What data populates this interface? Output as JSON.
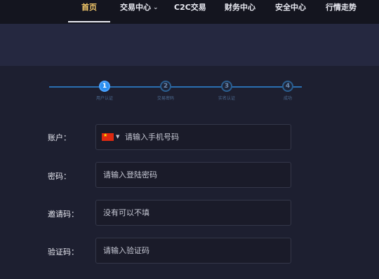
{
  "nav": {
    "items": [
      {
        "label": "首页",
        "active": true
      },
      {
        "label": "交易中心",
        "dropdown": true
      },
      {
        "label": "C2C交易"
      },
      {
        "label": "财务中心"
      },
      {
        "label": "安全中心"
      },
      {
        "label": "行情走势"
      }
    ]
  },
  "steps": [
    {
      "number": "1",
      "label": "用户认证",
      "active": true
    },
    {
      "number": "2",
      "label": "交易密码"
    },
    {
      "number": "3",
      "label": "实名认证"
    },
    {
      "number": "4",
      "label": "成功"
    }
  ],
  "form": {
    "account": {
      "label": "账户：",
      "placeholder": "请输入手机号码",
      "country_flag": "cn-flag-icon"
    },
    "password": {
      "label": "密码：",
      "placeholder": "请输入登陆密码"
    },
    "invite": {
      "label": "邀请码：",
      "placeholder": "没有可以不填"
    },
    "captcha": {
      "label": "验证码：",
      "placeholder": "请输入验证码"
    }
  },
  "colors": {
    "accent": "#2b8ff0",
    "nav_active": "#f3c86a",
    "background": "#1d1f30"
  }
}
